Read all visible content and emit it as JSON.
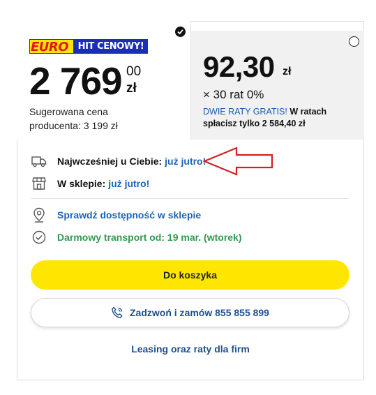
{
  "offer_regular": {
    "selected": true,
    "logo": {
      "left_text": "EURO",
      "right_text": "HIT CENOWY!"
    },
    "price_main": "2 769",
    "price_cents": "00",
    "currency": "zł",
    "suggested_price_line1": "Sugerowana cena",
    "suggested_price_line2": "producenta: 3 199 zł"
  },
  "offer_installments": {
    "selected": false,
    "amount": "92,30",
    "currency": "zł",
    "count_text": "× 30 rat 0%",
    "promo_highlight": "DWIE RATY GRATIS!",
    "promo_text_1": "W ratach",
    "promo_text_2": "spłacisz tylko 2 584,40 zł"
  },
  "delivery": {
    "earliest_label": "Najwcześniej u Ciebie:",
    "earliest_value": "już jutro!",
    "store_label": "W sklepie:",
    "store_value": "już jutro!",
    "check_store": "Sprawdź dostępność w sklepie",
    "free_transport": "Darmowy transport od: 19 mar. (wtorek)"
  },
  "actions": {
    "add_to_cart": "Do koszyka",
    "call_to_order": "Zadzwoń i zamów 855 855 899",
    "leasing": "Leasing oraz raty dla firm"
  },
  "colors": {
    "accent_yellow": "#ffe600",
    "link_blue": "#1e64b4",
    "success_green": "#2f9a50",
    "annotation_red": "#d42020"
  }
}
